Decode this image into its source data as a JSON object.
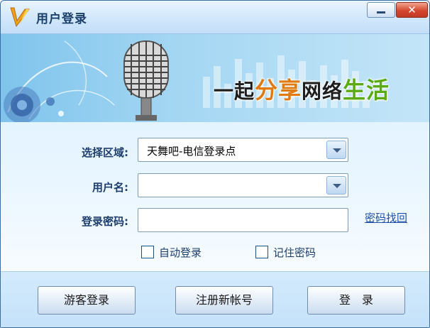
{
  "window": {
    "title": "用户登录",
    "minimize_symbol": "–",
    "close_symbol": "✕"
  },
  "banner": {
    "slogan_part1": "一起",
    "slogan_part2": "分享",
    "slogan_part3": "网络",
    "slogan_part4": "生活"
  },
  "form": {
    "region_label": "选择区域:",
    "region_value": "天舞吧-电信登录点",
    "username_label": "用户名:",
    "username_value": "",
    "password_label": "登录密码:",
    "password_value": "",
    "recover_link": "密码找回",
    "auto_login_label": "自动登录",
    "auto_login_checked": false,
    "remember_label": "记住密码",
    "remember_checked": false
  },
  "buttons": {
    "guest": "游客登录",
    "register": "注册新帐号",
    "login": "登　录"
  },
  "colors": {
    "title_text": "#1b3f6b",
    "label_text": "#1e3e6e",
    "link": "#1f4fa8",
    "close_button": "#d4472f",
    "slogan_orange": "#e07a12",
    "slogan_green": "#5aaa12"
  },
  "icons": {
    "app_logo": "brand-v-logo-icon",
    "microphone": "microphone-icon",
    "dropdown": "chevron-down-icon"
  }
}
